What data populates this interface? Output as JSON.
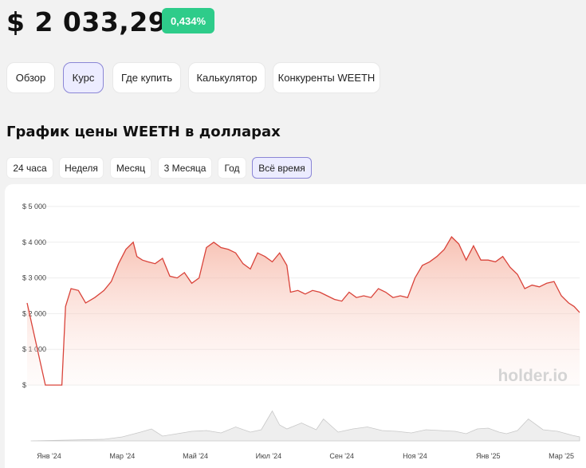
{
  "header": {
    "price": "$ 2 033,29",
    "change_badge": "0,434%"
  },
  "tabs": [
    {
      "label": "Обзор",
      "active": false
    },
    {
      "label": "Курс",
      "active": true
    },
    {
      "label": "Где купить",
      "active": false
    },
    {
      "label": "Калькулятор",
      "active": false
    },
    {
      "label": "Конкуренты WEETH",
      "active": false
    }
  ],
  "chart_section": {
    "title": "График цены WEETH в долларах"
  },
  "periods": [
    {
      "label": "24 часа",
      "active": false
    },
    {
      "label": "Неделя",
      "active": false
    },
    {
      "label": "Месяц",
      "active": false
    },
    {
      "label": "3 Месяца",
      "active": false
    },
    {
      "label": "Год",
      "active": false
    },
    {
      "label": "Всё время",
      "active": true
    }
  ],
  "watermark": "holder.io",
  "colors": {
    "badge": "#2ecc8a",
    "line": "#d9433a",
    "active_tab_border": "#8b86d6"
  },
  "chart_data": {
    "type": "area",
    "y_tick_labels": [
      "$ 5 000",
      "$ 4 000",
      "$ 3 000",
      "$ 2 000",
      "$ 1 000",
      "$"
    ],
    "y_ticks": [
      5000,
      4000,
      3000,
      2000,
      1000,
      0
    ],
    "ylim": [
      0,
      5000
    ],
    "x_tick_labels": [
      "Янв '24",
      "Мар '24",
      "Май '24",
      "Июл '24",
      "Сен '24",
      "Ноя '24",
      "Янв '25",
      "Мар '25"
    ],
    "x_ticks": [
      1.5,
      3.5,
      5.5,
      7.5,
      9.5,
      11.5,
      13.5,
      15.5
    ],
    "xlim": [
      0.9,
      16.0
    ],
    "grid": true,
    "price_series": {
      "x": [
        0.9,
        1.4,
        1.85,
        1.95,
        2.1,
        2.3,
        2.5,
        2.75,
        3.0,
        3.2,
        3.4,
        3.6,
        3.8,
        3.9,
        4.05,
        4.2,
        4.4,
        4.6,
        4.8,
        5.0,
        5.2,
        5.4,
        5.6,
        5.8,
        6.0,
        6.2,
        6.4,
        6.6,
        6.8,
        7.0,
        7.2,
        7.4,
        7.6,
        7.8,
        8.0,
        8.1,
        8.3,
        8.5,
        8.7,
        8.9,
        9.1,
        9.3,
        9.5,
        9.7,
        9.9,
        10.1,
        10.3,
        10.5,
        10.7,
        10.9,
        11.1,
        11.3,
        11.5,
        11.7,
        11.9,
        12.1,
        12.3,
        12.5,
        12.7,
        12.9,
        13.1,
        13.3,
        13.5,
        13.7,
        13.9,
        14.1,
        14.3,
        14.5,
        14.7,
        14.9,
        15.1,
        15.3,
        15.5,
        15.7,
        15.85,
        16.0
      ],
      "y": [
        2300,
        0,
        0,
        2200,
        2700,
        2650,
        2300,
        2450,
        2650,
        2900,
        3400,
        3800,
        4000,
        3600,
        3500,
        3450,
        3400,
        3550,
        3050,
        3000,
        3150,
        2850,
        3000,
        3850,
        4000,
        3850,
        3800,
        3700,
        3400,
        3250,
        3700,
        3600,
        3450,
        3700,
        3350,
        2600,
        2650,
        2550,
        2650,
        2600,
        2500,
        2400,
        2350,
        2600,
        2450,
        2500,
        2450,
        2700,
        2600,
        2450,
        2500,
        2450,
        3000,
        3350,
        3450,
        3600,
        3800,
        4150,
        3950,
        3500,
        3900,
        3500,
        3500,
        3450,
        3600,
        3300,
        3100,
        2700,
        2800,
        2750,
        2850,
        2900,
        2500,
        2300,
        2200,
        2033
      ]
    },
    "volume_series": {
      "x": [
        1.0,
        2.0,
        3.0,
        3.5,
        4.0,
        4.3,
        4.6,
        5.0,
        5.4,
        5.8,
        6.2,
        6.6,
        7.0,
        7.3,
        7.6,
        7.8,
        8.0,
        8.4,
        8.8,
        9.0,
        9.4,
        9.8,
        10.2,
        10.6,
        11.0,
        11.4,
        11.8,
        12.2,
        12.6,
        12.9,
        13.2,
        13.5,
        13.8,
        14.0,
        14.3,
        14.6,
        15.0,
        15.4,
        15.8,
        16.0
      ],
      "y": [
        0,
        2,
        4,
        10,
        22,
        30,
        12,
        18,
        24,
        26,
        20,
        35,
        22,
        28,
        75,
        40,
        30,
        45,
        28,
        55,
        22,
        30,
        35,
        26,
        24,
        20,
        28,
        26,
        24,
        18,
        30,
        32,
        22,
        18,
        26,
        55,
        28,
        24,
        14,
        10
      ]
    }
  }
}
